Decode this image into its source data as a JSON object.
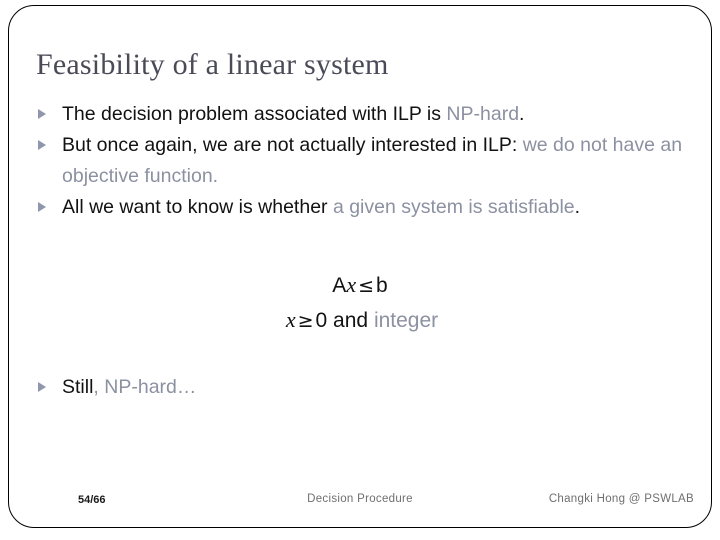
{
  "slide": {
    "title": "Feasibility of a linear system",
    "accent_dark": "#121212",
    "accent_gray": "#8c91a2",
    "title_color": "#4b4b58",
    "bullet_marker_color": "#8f96ae",
    "border_color": "#000000"
  },
  "bullets": [
    {
      "marker": "triangle-bullet-icon",
      "parts": [
        {
          "text": "The decision problem associated with ILP is ",
          "tone": "dark"
        },
        {
          "text": "NP-hard",
          "tone": "gray"
        },
        {
          "text": ".",
          "tone": "dark"
        }
      ]
    },
    {
      "marker": "triangle-bullet-icon",
      "parts": [
        {
          "text": "But once again, we are not actually interested in ILP: ",
          "tone": "dark"
        },
        {
          "text": "we do not have an objective function.",
          "tone": "gray"
        }
      ]
    },
    {
      "marker": "triangle-bullet-icon",
      "parts": [
        {
          "text": "All we want to know is whether ",
          "tone": "dark"
        },
        {
          "text": "a given system is satisfiable",
          "tone": "gray"
        },
        {
          "text": ".",
          "tone": "dark"
        }
      ]
    }
  ],
  "formulas": {
    "line1": {
      "matrix": "A",
      "variable": "x",
      "relation": "≤",
      "vector": "b"
    },
    "line2": {
      "variable": "x",
      "relation": "≥",
      "value": "0",
      "conjunction": "and",
      "qualifier": "integer"
    }
  },
  "last_bullet": {
    "marker": "triangle-bullet-icon",
    "parts": [
      {
        "text": "Still",
        "tone": "dark"
      },
      {
        "text": ", ",
        "tone": "gray"
      },
      {
        "text": "NP-hard…",
        "tone": "gray"
      }
    ]
  },
  "footer": {
    "page": "54/66",
    "center": "Decision Procedure",
    "right": "Changki Hong @ PSWLAB"
  }
}
